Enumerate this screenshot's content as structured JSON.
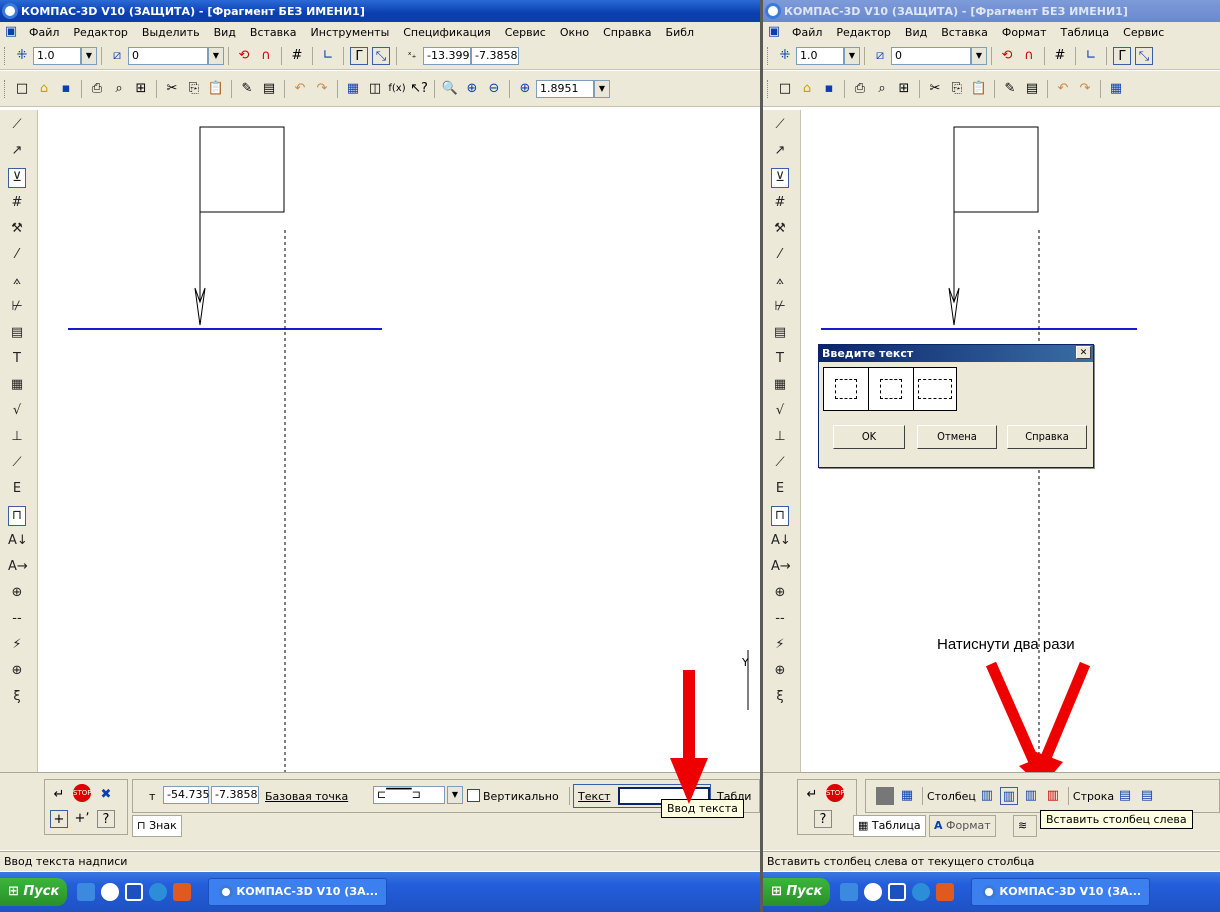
{
  "left": {
    "title": "КОМПАС-3D V10 (ЗАЩИТА) - [Фрагмент БЕЗ ИМЕНИ1]",
    "menu": [
      "Файл",
      "Редактор",
      "Выделить",
      "Вид",
      "Вставка",
      "Инструменты",
      "Спецификация",
      "Сервис",
      "Окно",
      "Справка",
      "Библ"
    ],
    "toolbar1": {
      "step": "1.0",
      "layer": "0",
      "coord_x": "-13.399",
      "coord_y": "-7.3858"
    },
    "toolbar2": {
      "zoom": "1.8951"
    },
    "props": {
      "t_label": "т",
      "t_x": "-54.735",
      "t_y": "-7.3858",
      "base_point_label": "Базовая точка",
      "vertical_label": "Вертикально",
      "text_label": "Текст",
      "text_value": "",
      "table_label": "Табли",
      "tab_sign": "Знак"
    },
    "tooltip": "Ввод текста",
    "status": "Ввод текста надписи",
    "axis_label": "Y"
  },
  "right": {
    "title": "КОМПАС-3D V10 (ЗАЩИТА) - [Фрагмент БЕЗ ИМЕНИ1]",
    "menu": [
      "Файл",
      "Редактор",
      "Вид",
      "Вставка",
      "Формат",
      "Таблица",
      "Сервис"
    ],
    "toolbar1": {
      "step": "1.0",
      "layer": "0"
    },
    "dialog": {
      "title": "Введите текст",
      "ok": "OK",
      "cancel": "Отмена",
      "help": "Справка"
    },
    "annotation": "Натиснути два рази",
    "props": {
      "column_label": "Столбец",
      "row_label": "Строка",
      "tab_table": "Таблица",
      "tab_format": "Формат"
    },
    "tooltip": "Вставить столбец слева",
    "status": "Вставить столбец слева от текущего столбца"
  },
  "taskbar": {
    "start": "Пуск",
    "item": "КОМПАС-3D V10 (ЗА..."
  },
  "colors": {
    "accent": "#0a3fb0",
    "line": "#1a1acc",
    "arrow": "#ee0000"
  }
}
